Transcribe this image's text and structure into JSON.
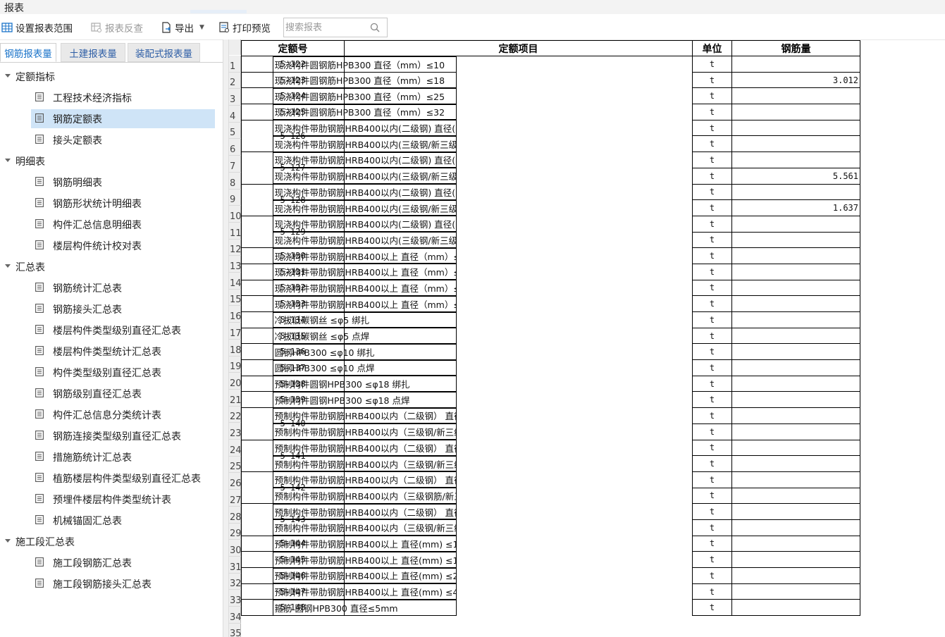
{
  "window": {
    "title": "报表"
  },
  "toolbar": {
    "set_range": "设置报表范围",
    "report_check": "报表反查",
    "export": "导出",
    "print_preview": "打印预览",
    "search_placeholder": "搜索报表"
  },
  "tabs": [
    {
      "label": "钢筋报表量",
      "active": true
    },
    {
      "label": "土建报表量",
      "active": false
    },
    {
      "label": "装配式报表量",
      "active": false
    }
  ],
  "tree": {
    "groups": [
      {
        "label": "定额指标",
        "items": [
          "工程技术经济指标",
          "钢筋定额表",
          "接头定额表"
        ]
      },
      {
        "label": "明细表",
        "items": [
          "钢筋明细表",
          "钢筋形状统计明细表",
          "构件汇总信息明细表",
          "楼层构件统计校对表"
        ]
      },
      {
        "label": "汇总表",
        "items": [
          "钢筋统计汇总表",
          "钢筋接头汇总表",
          "楼层构件类型级别直径汇总表",
          "楼层构件类型统计汇总表",
          "构件类型级别直径汇总表",
          "钢筋级别直径汇总表",
          "构件汇总信息分类统计表",
          "钢筋连接类型级别直径汇总表",
          "措施筋统计汇总表",
          "植筋楼层构件类型级别直径汇总表",
          "预埋件楼层构件类型统计表",
          "机械锚固汇总表"
        ]
      },
      {
        "label": "施工段汇总表",
        "items": [
          "施工段钢筋汇总表",
          "施工段钢筋接头汇总表"
        ]
      }
    ],
    "selected": "钢筋定额表"
  },
  "table": {
    "headers": [
      "定额号",
      "定额项目",
      "单位",
      "钢筋量"
    ],
    "rows": [
      {
        "n": "1",
        "code": "5-122",
        "item": "现浇构件圆钢筋HPB300 直径（mm）≤10",
        "unit": "t",
        "qty": ""
      },
      {
        "n": "2",
        "code": "5-123",
        "item": "现浇构件圆钢筋HPB300 直径（mm）≤18",
        "unit": "t",
        "qty": "3.012"
      },
      {
        "n": "3",
        "code": "5-124",
        "item": "现浇构件圆钢筋HPB300 直径（mm）≤25",
        "unit": "t",
        "qty": ""
      },
      {
        "n": "4",
        "code": "5-125",
        "item": "现浇构件圆钢筋HPB300 直径（mm）≤32",
        "unit": "t",
        "qty": ""
      },
      {
        "n": "5",
        "code": "5-126",
        "item": "现浇构件带肋钢筋HRB400以内(二级钢) 直径(mm) ≤10",
        "unit": "t",
        "qty": ""
      },
      {
        "n": "6",
        "code": "",
        "item": "现浇构件带肋钢筋HRB400以内(三级钢/新三级钢) 直径(mm) ≤10",
        "unit": "t",
        "qty": ""
      },
      {
        "n": "7",
        "code": "5-127",
        "item": "现浇构件带肋钢筋HRB400以内(二级钢) 直径(mm) ≤18",
        "unit": "t",
        "qty": ""
      },
      {
        "n": "8",
        "code": "",
        "item": "现浇构件带肋钢筋HRB400以内(三级钢/新三级钢) 直径(mm) ≤18",
        "unit": "t",
        "qty": "5.561"
      },
      {
        "n": "9",
        "code": "5-128",
        "item": "现浇构件带肋钢筋HRB400以内(二级钢) 直径(mm) ≤25",
        "unit": "t",
        "qty": ""
      },
      {
        "n": "10",
        "code": "",
        "item": "现浇构件带肋钢筋HRB400以内(三级钢/新三级钢) 直径(mm) ≤25",
        "unit": "t",
        "qty": "1.637"
      },
      {
        "n": "11",
        "code": "5-129",
        "item": "现浇构件带肋钢筋HRB400以内(二级钢) 直径(mm) ≤40",
        "unit": "t",
        "qty": ""
      },
      {
        "n": "12",
        "code": "",
        "item": "现浇构件带肋钢筋HRB400以内(三级钢/新三级钢) 直径(mm) ≤40",
        "unit": "t",
        "qty": ""
      },
      {
        "n": "13",
        "code": "5-130",
        "item": "现浇构件带肋钢筋HRB400以上 直径（mm）≤10",
        "unit": "t",
        "qty": ""
      },
      {
        "n": "14",
        "code": "5-131",
        "item": "现浇构件带肋钢筋HRB400以上 直径（mm）≤18",
        "unit": "t",
        "qty": ""
      },
      {
        "n": "15",
        "code": "5-132",
        "item": "现浇构件带肋钢筋HRB400以上 直径（mm）≤25",
        "unit": "t",
        "qty": ""
      },
      {
        "n": "16",
        "code": "5-133",
        "item": "现浇构件带肋钢筋HRB400以上 直径（mm）≤40",
        "unit": "t",
        "qty": ""
      },
      {
        "n": "17",
        "code": "5-134",
        "item": "冷拔低碳钢丝 ≤φ5 绑扎",
        "unit": "t",
        "qty": ""
      },
      {
        "n": "18",
        "code": "5-135",
        "item": "冷拔低碳钢丝 ≤φ5 点焊",
        "unit": "t",
        "qty": ""
      },
      {
        "n": "19",
        "code": "5-136",
        "item": "圆钢HPB300 ≤φ10 绑扎",
        "unit": "t",
        "qty": ""
      },
      {
        "n": "20",
        "code": "5-137",
        "item": "圆钢HPB300 ≤φ10 点焊",
        "unit": "t",
        "qty": ""
      },
      {
        "n": "21",
        "code": "5-138",
        "item": "预制构件圆钢HPB300 ≤φ18 绑扎",
        "unit": "t",
        "qty": ""
      },
      {
        "n": "22",
        "code": "5-139",
        "item": "预制构件圆钢HPB300 ≤φ18 点焊",
        "unit": "t",
        "qty": ""
      },
      {
        "n": "23",
        "code": "5-140",
        "item": "预制构件带肋钢筋HRB400以内（二级钢） 直径(mm) ≤10",
        "unit": "t",
        "qty": ""
      },
      {
        "n": "24",
        "code": "",
        "item": "预制构件带肋钢筋HRB400以内（三级钢/新三级钢） 直径(mm) ≤10",
        "unit": "t",
        "qty": ""
      },
      {
        "n": "25",
        "code": "5-141",
        "item": "预制构件带肋钢筋HRB400以内（二级钢） 直径(mm) ≤18",
        "unit": "t",
        "qty": ""
      },
      {
        "n": "26",
        "code": "",
        "item": "预制构件带肋钢筋HRB400以内（三级钢/新三级钢） 直径(mm) ≤18",
        "unit": "t",
        "qty": ""
      },
      {
        "n": "27",
        "code": "5-142",
        "item": "预制构件带肋钢筋HRB400以内（二级钢） 直径(mm) ≤25",
        "unit": "t",
        "qty": ""
      },
      {
        "n": "28",
        "code": "",
        "item": "预制构件带肋钢筋HRB400以内（三级钢筋/新三级钢） 直径(mm) ≤25",
        "unit": "t",
        "qty": ""
      },
      {
        "n": "29",
        "code": "5-143",
        "item": "预制构件带肋钢筋HRB400以内（二级钢） 直径(mm) ≤40",
        "unit": "t",
        "qty": ""
      },
      {
        "n": "30",
        "code": "",
        "item": "预制构件带肋钢筋HRB400以内（三级钢/新三级钢） 直径(mm) ≤40",
        "unit": "t",
        "qty": ""
      },
      {
        "n": "31",
        "code": "5-144",
        "item": "预制构件带肋钢筋HRB400以上 直径(mm) ≤10",
        "unit": "t",
        "qty": ""
      },
      {
        "n": "32",
        "code": "5-145",
        "item": "预制构件带肋钢筋HRB400以上 直径(mm) ≤18",
        "unit": "t",
        "qty": ""
      },
      {
        "n": "33",
        "code": "5-146",
        "item": "预制构件带肋钢筋HRB400以上 直径(mm) ≤25",
        "unit": "t",
        "qty": ""
      },
      {
        "n": "34",
        "code": "5-147",
        "item": "预制构件带肋钢筋HRB400以上 直径(mm) ≤40",
        "unit": "t",
        "qty": ""
      },
      {
        "n": "35",
        "code": "5-148",
        "item": "箍筋 圆钢HPB300 直径≤5mm",
        "unit": "t",
        "qty": ""
      }
    ]
  }
}
